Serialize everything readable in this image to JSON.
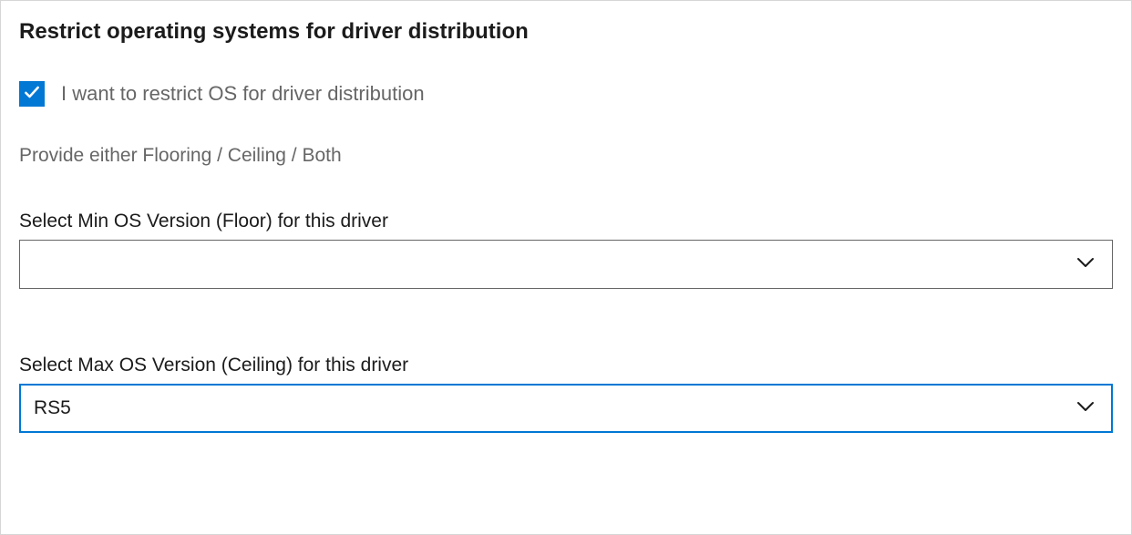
{
  "section": {
    "title": "Restrict operating systems for driver distribution"
  },
  "checkbox": {
    "label": "I want to restrict OS for driver distribution",
    "checked": true
  },
  "hint": "Provide either Flooring / Ceiling / Both",
  "minOs": {
    "label": "Select Min OS Version (Floor) for this driver",
    "value": ""
  },
  "maxOs": {
    "label": "Select Max OS Version (Ceiling) for this driver",
    "value": "RS5"
  },
  "colors": {
    "accent": "#0078d4",
    "border": "#666666",
    "textMuted": "#666666"
  }
}
